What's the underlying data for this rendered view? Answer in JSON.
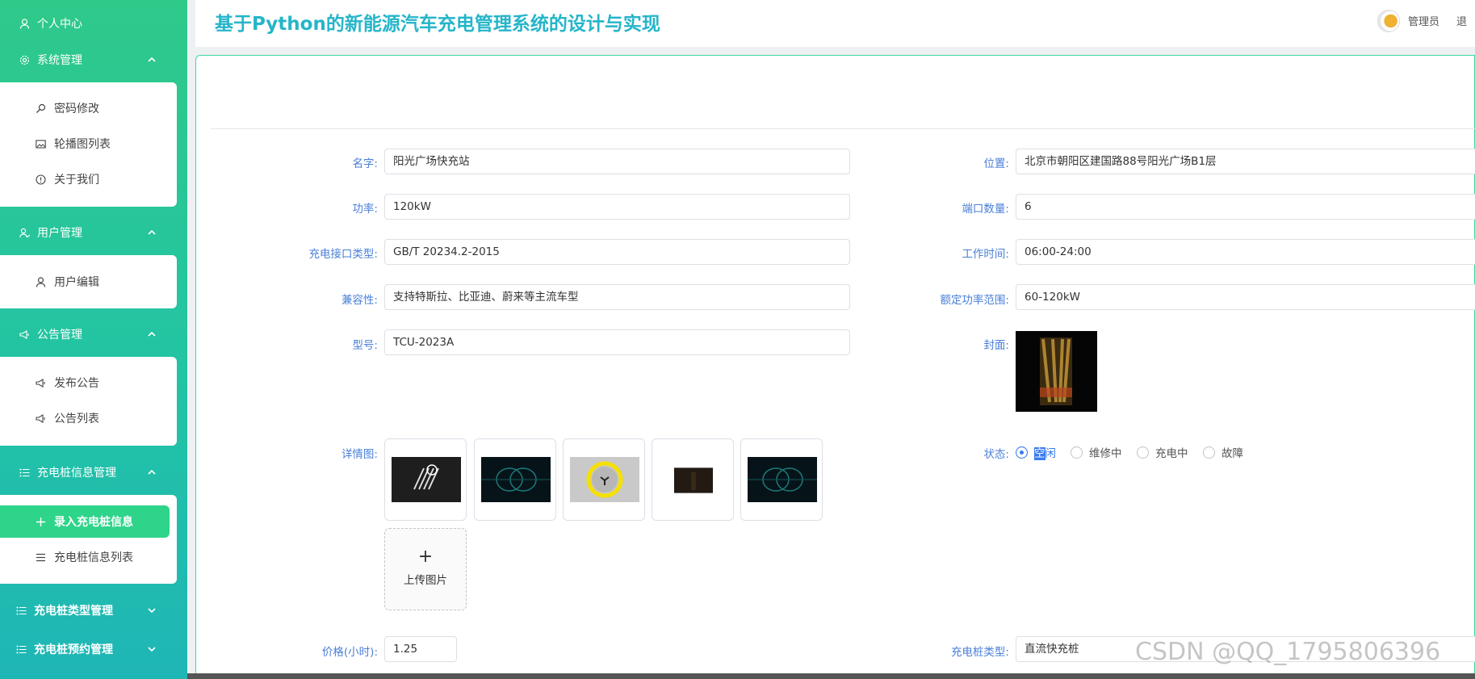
{
  "header": {
    "title": "基于Python的新能源汽车充电管理系统的设计与实现",
    "admin": "管理员",
    "logout": "退"
  },
  "sidebar": {
    "personal_center": "个人中心",
    "system_mgmt": {
      "label": "系统管理",
      "items": [
        "密码修改",
        "轮播图列表",
        "关于我们"
      ]
    },
    "user_mgmt": {
      "label": "用户管理",
      "items": [
        "用户编辑"
      ]
    },
    "notice_mgmt": {
      "label": "公告管理",
      "items": [
        "发布公告",
        "公告列表"
      ]
    },
    "pile_info_mgmt": {
      "label": "充电桩信息管理",
      "items": [
        "录入充电桩信息",
        "充电桩信息列表"
      ]
    },
    "pile_type_mgmt": "充电桩类型管理",
    "pile_booking_mgmt": "充电桩预约管理"
  },
  "form": {
    "name": {
      "label": "名字:",
      "value": "阳光广场快充站"
    },
    "location": {
      "label": "位置:",
      "value": "北京市朝阳区建国路88号阳光广场B1层"
    },
    "power": {
      "label": "功率:",
      "value": "120kW"
    },
    "ports": {
      "label": "端口数量:",
      "value": "6"
    },
    "interface": {
      "label": "充电接口类型:",
      "value": "GB/T 20234.2-2015"
    },
    "hours": {
      "label": "工作时间:",
      "value": "06:00-24:00"
    },
    "compat": {
      "label": "兼容性:",
      "value": "支持特斯拉、比亚迪、蔚来等主流车型"
    },
    "rated": {
      "label": "额定功率范围:",
      "value": "60-120kW"
    },
    "model": {
      "label": "型号:",
      "value": "TCU-2023A"
    },
    "cover": {
      "label": "封面:"
    },
    "details": {
      "label": "详情图:",
      "upload": "上传图片"
    },
    "status": {
      "label": "状态:",
      "options": [
        "空闲",
        "维修中",
        "充电中",
        "故障"
      ],
      "selected": "空闲",
      "first_a": "空",
      "first_b": "闲"
    },
    "price": {
      "label": "价格(小时):",
      "value": "1.25"
    },
    "pile_type": {
      "label": "充电桩类型:",
      "value": "直流快充桩"
    }
  },
  "watermark": "CSDN @QQ_1795806396",
  "colors": {
    "sidebar_top": "#2fc98a",
    "sidebar_bottom": "#1fb6b6",
    "accent": "#2ed489",
    "title": "#25b5c9",
    "label": "#4a7fd8",
    "radio": "#3a7bf0"
  }
}
